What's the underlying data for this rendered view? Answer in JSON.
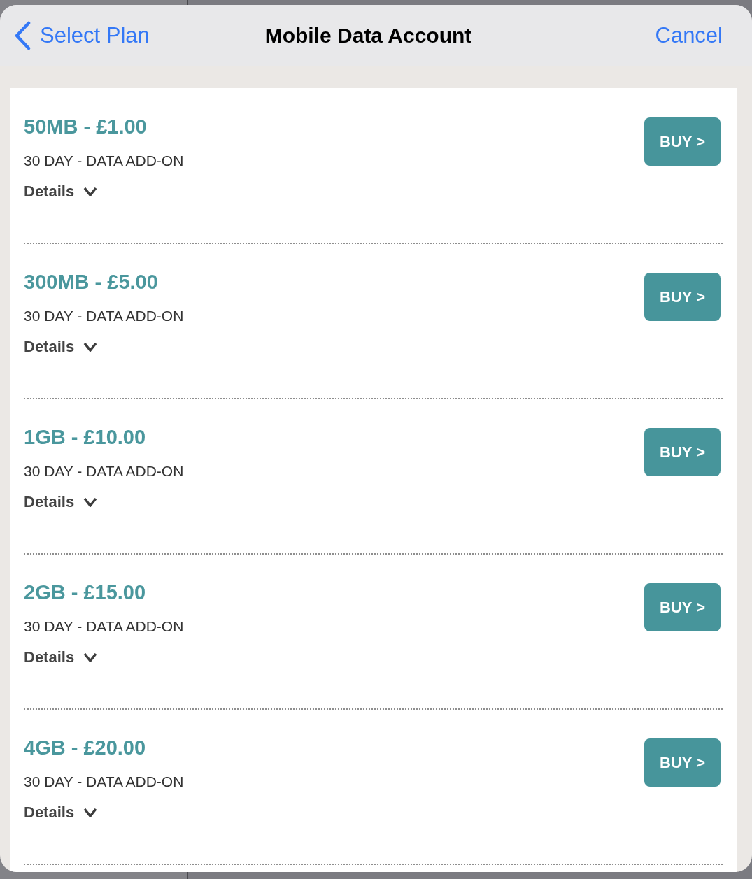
{
  "nav_bar": {
    "back_label": "Select Plan",
    "title": "Mobile Data Account",
    "cancel_label": "Cancel"
  },
  "plans": [
    {
      "title": "50MB - £1.00",
      "subtitle": "30 DAY - DATA ADD-ON",
      "details_label": "Details",
      "expanded": false,
      "buy_label": "BUY >"
    },
    {
      "title": "300MB - £5.00",
      "subtitle": "30 DAY - DATA ADD-ON",
      "details_label": "Details",
      "expanded": false,
      "buy_label": "BUY >"
    },
    {
      "title": "1GB - £10.00",
      "subtitle": "30 DAY - DATA ADD-ON",
      "details_label": "Details",
      "expanded": false,
      "buy_label": "BUY >"
    },
    {
      "title": "2GB - £15.00",
      "subtitle": "30 DAY - DATA ADD-ON",
      "details_label": "Details",
      "expanded": false,
      "buy_label": "BUY >"
    },
    {
      "title": "4GB - £20.00",
      "subtitle": "30 DAY - DATA ADD-ON",
      "details_label": "Details",
      "expanded": false,
      "buy_label": "BUY >"
    }
  ]
}
